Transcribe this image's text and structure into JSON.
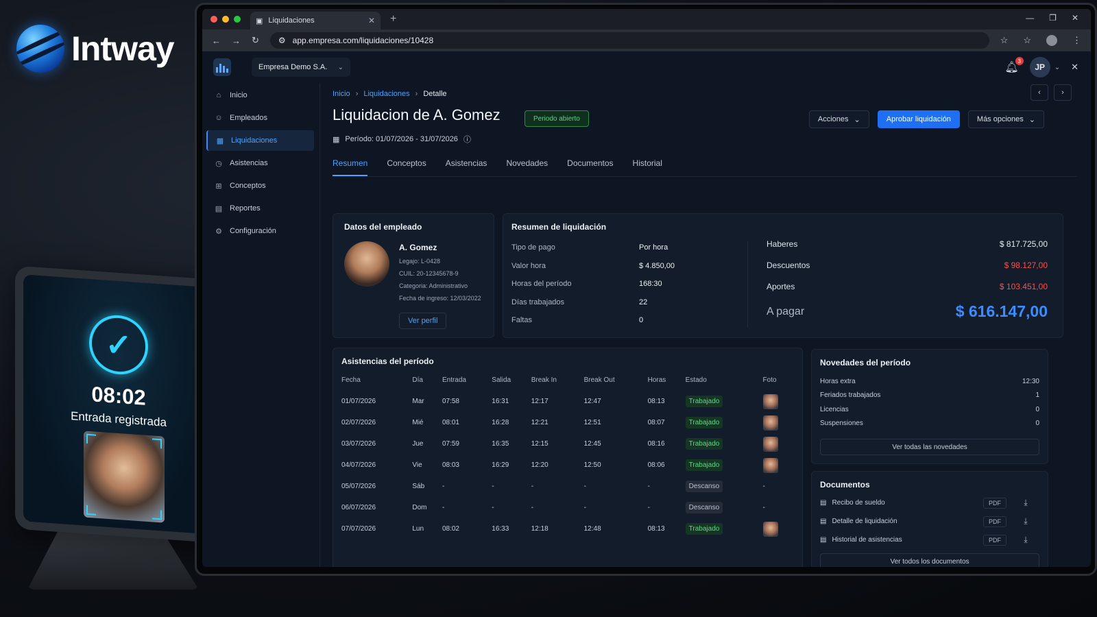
{
  "logo": {
    "text": "Intway"
  },
  "browser": {
    "tab_title": "Liquidaciones",
    "url": "app.empresa.com/liquidaciones/10428"
  },
  "app": {
    "company": "Empresa Demo S.A.",
    "notifications_count": "3",
    "user_initials": "JP"
  },
  "sidebar": {
    "items": [
      {
        "label": "Inicio",
        "icon": "home-icon"
      },
      {
        "label": "Empleados",
        "icon": "users-icon"
      },
      {
        "label": "Liquidaciones",
        "icon": "calendar-icon",
        "active": true
      },
      {
        "label": "Asistencias",
        "icon": "clock-icon"
      },
      {
        "label": "Conceptos",
        "icon": "grid-icon"
      },
      {
        "label": "Reportes",
        "icon": "document-icon"
      },
      {
        "label": "Configuración",
        "icon": "gear-icon"
      }
    ]
  },
  "breadcrumb": {
    "home": "Inicio",
    "section": "Liquidaciones",
    "current": "Detalle"
  },
  "header": {
    "title": "Liquidacion de A. Gomez",
    "status": "Periodo abierto",
    "period": "Período: 01/07/2026 - 31/07/2026",
    "actions_label": "Acciones",
    "approve_label": "Aprobar liquidación",
    "more_label": "Más opciones"
  },
  "tabs": [
    "Resumen",
    "Conceptos",
    "Asistencias",
    "Novedades",
    "Documentos",
    "Historial"
  ],
  "employee": {
    "title": "Datos del empleado",
    "name": "A. Gomez",
    "legajo": "Legajo: L-0428",
    "cuil": "CUIL: 20-12345678-9",
    "categoria": "Categoria: Administrativo",
    "ingreso": "Fecha de ingreso: 12/03/2022",
    "profile_button": "Ver perfil"
  },
  "summary": {
    "title": "Resumen de liquidación",
    "rows": [
      {
        "k": "Tipo de pago",
        "v": "Por hora"
      },
      {
        "k": "Valor hora",
        "v": "$ 4.850,00"
      },
      {
        "k": "Horas del período",
        "v": "168:30"
      },
      {
        "k": "Días trabajados",
        "v": "22"
      },
      {
        "k": "Faltas",
        "v": "0"
      }
    ],
    "haberes_label": "Haberes",
    "haberes": "$ 817.725,00",
    "descuentos_label": "Descuentos",
    "descuentos": "$ 98.127,00",
    "aportes_label": "Aportes",
    "aportes": "$ 103.451,00",
    "apagar_label": "A pagar",
    "apagar": "$ 616.147,00"
  },
  "attendance": {
    "title": "Asistencias del período",
    "headers": [
      "Fecha",
      "Día",
      "Entrada",
      "Salida",
      "Break In",
      "Break Out",
      "Horas",
      "Estado",
      "Foto"
    ],
    "rows": [
      [
        "01/07/2026",
        "Mar",
        "07:58",
        "16:31",
        "12:17",
        "12:47",
        "08:13",
        "Trabajado",
        "photo"
      ],
      [
        "02/07/2026",
        "Mié",
        "08:01",
        "16:28",
        "12:21",
        "12:51",
        "08:07",
        "Trabajado",
        "photo"
      ],
      [
        "03/07/2026",
        "Jue",
        "07:59",
        "16:35",
        "12:15",
        "12:45",
        "08:16",
        "Trabajado",
        "photo"
      ],
      [
        "04/07/2026",
        "Vie",
        "08:03",
        "16:29",
        "12:20",
        "12:50",
        "08:06",
        "Trabajado",
        "photo"
      ],
      [
        "05/07/2026",
        "Sáb",
        "-",
        "-",
        "-",
        "-",
        "-",
        "Descanso",
        "-"
      ],
      [
        "06/07/2026",
        "Dom",
        "-",
        "-",
        "-",
        "-",
        "-",
        "Descanso",
        "-"
      ],
      [
        "07/07/2026",
        "Lun",
        "08:02",
        "16:33",
        "12:18",
        "12:48",
        "08:13",
        "Trabajado",
        "photo"
      ]
    ]
  },
  "novedades": {
    "title": "Novedades del período",
    "rows": [
      {
        "k": "Horas extra",
        "v": "12:30"
      },
      {
        "k": "Feriados trabajados",
        "v": "1"
      },
      {
        "k": "Licencias",
        "v": "0"
      },
      {
        "k": "Suspensiones",
        "v": "0"
      }
    ],
    "button": "Ver todas las novedades"
  },
  "documentos": {
    "title": "Documentos",
    "rows": [
      {
        "name": "Recibo de sueldo",
        "type": "PDF"
      },
      {
        "name": "Detalle de liquidación",
        "type": "PDF"
      },
      {
        "name": "Historial de asistencias",
        "type": "PDF"
      }
    ],
    "button": "Ver todos los documentos"
  },
  "tablet": {
    "time": "08:02",
    "message": "Entrada registrada"
  },
  "colors": {
    "accent": "#1f6ff2",
    "success": "#57d683",
    "danger": "#ff4d4d"
  }
}
